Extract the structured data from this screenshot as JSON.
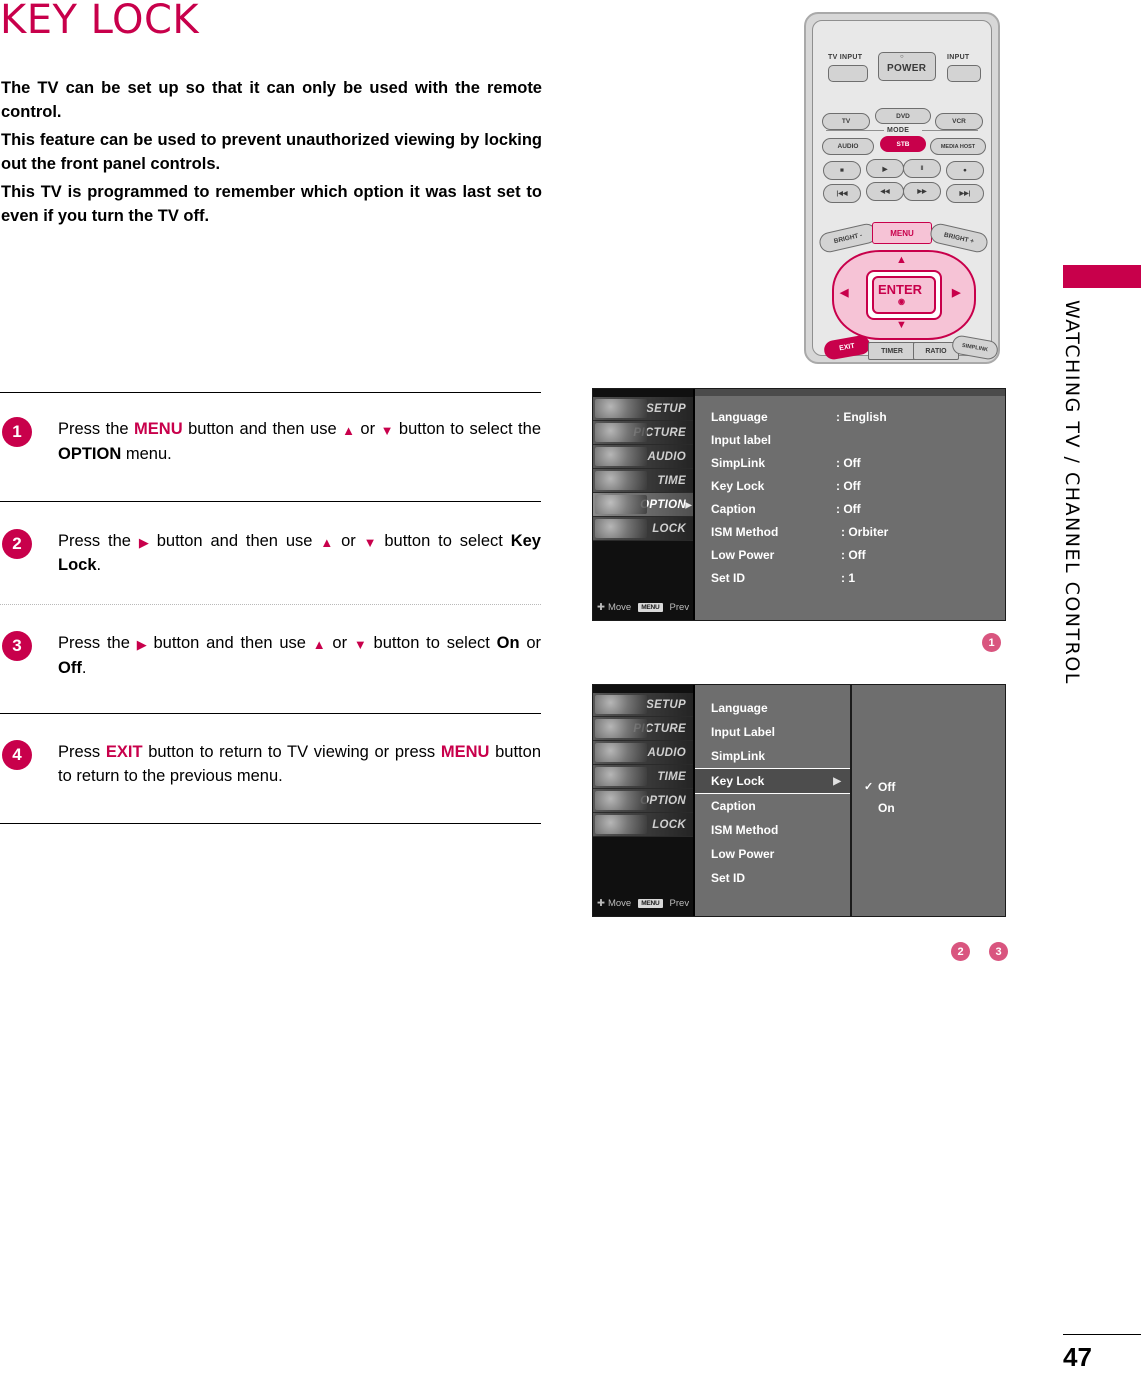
{
  "title": "KEY LOCK",
  "intro": {
    "p1": "The TV can be set up so that it can only be used with the remote control.",
    "p2": "This feature can be used to prevent unauthorized viewing by locking out the front panel controls.",
    "p3": "This TV is programmed to remember which option it was last set to even if you turn the TV off."
  },
  "steps": [
    {
      "num": "1",
      "seg": [
        "Press the ",
        "MENU",
        " button and then use ",
        "▲",
        " or ",
        "▼",
        " button to select the ",
        "OPTION",
        " menu."
      ]
    },
    {
      "num": "2",
      "seg": [
        "Press the ",
        "▶",
        " button and then use ",
        "▲",
        " or ",
        "▼",
        " button to select ",
        "Key Lock",
        "."
      ]
    },
    {
      "num": "3",
      "seg": [
        "Press the ",
        "▶",
        " button and then use ",
        "▲",
        " or ",
        "▼",
        " button to select ",
        "On",
        " or ",
        "Off",
        "."
      ]
    },
    {
      "num": "4",
      "seg": [
        "Press ",
        "EXIT",
        " button to return to TV viewing or press ",
        "MENU",
        " button to return to the previous menu."
      ]
    }
  ],
  "sidebar": {
    "label": "WATCHING TV / CHANNEL CONTROL"
  },
  "footer": {
    "page_number": "47"
  },
  "remote": {
    "tv_input": "TV INPUT",
    "power": "POWER",
    "power_symbol": "○",
    "input": "INPUT",
    "mode": "MODE",
    "tv": "TV",
    "dvd": "DVD",
    "vcr": "VCR",
    "audio": "AUDIO",
    "stb": "STB",
    "media_host": "MEDIA HOST",
    "stop": "■",
    "play": "▶",
    "pause": "‖",
    "record": "●",
    "skip_back": "|◀◀",
    "rewind": "◀◀",
    "forward": "▶▶",
    "skip_fwd": "▶▶|",
    "bright_minus": "BRIGHT -",
    "menu": "MENU",
    "bright_plus": "BRIGHT +",
    "up": "▲",
    "down": "▼",
    "left": "◀",
    "right": "▶",
    "enter": "ENTER",
    "enter_dot": "◉",
    "exit": "EXIT",
    "timer": "TIMER",
    "ratio": "RATIO",
    "simplink": "SIMPLINK"
  },
  "osd1": {
    "badge": "1",
    "side_items": [
      {
        "label": "SETUP",
        "selected": false
      },
      {
        "label": "PICTURE",
        "selected": false
      },
      {
        "label": "AUDIO",
        "selected": false
      },
      {
        "label": "TIME",
        "selected": false
      },
      {
        "label": "OPTION",
        "selected": true
      },
      {
        "label": "LOCK",
        "selected": false
      }
    ],
    "footer_move": "Move",
    "footer_menu_key": "MENU",
    "footer_prev": "Prev",
    "rows": [
      {
        "label": "Language",
        "value": ": English"
      },
      {
        "label": "Input label",
        "value": ""
      },
      {
        "label": "SimpLink",
        "value": ": Off"
      },
      {
        "label": "Key Lock",
        "value": ": Off"
      },
      {
        "label": "Caption",
        "value": ": Off"
      },
      {
        "label": "ISM Method",
        "value": ": Orbiter"
      },
      {
        "label": "Low Power",
        "value": ": Off"
      },
      {
        "label": "Set ID",
        "value": ": 1"
      }
    ]
  },
  "osd2": {
    "badges": [
      "2",
      "3"
    ],
    "side_items": [
      {
        "label": "SETUP",
        "selected": false
      },
      {
        "label": "PICTURE",
        "selected": false
      },
      {
        "label": "AUDIO",
        "selected": false
      },
      {
        "label": "TIME",
        "selected": false
      },
      {
        "label": "OPTION",
        "selected": false
      },
      {
        "label": "LOCK",
        "selected": false
      }
    ],
    "footer_move": "Move",
    "footer_menu_key": "MENU",
    "footer_prev": "Prev",
    "items": [
      {
        "label": "Language",
        "selected": false
      },
      {
        "label": "Input Label",
        "selected": false
      },
      {
        "label": "SimpLink",
        "selected": false
      },
      {
        "label": "Key Lock",
        "selected": true
      },
      {
        "label": "Caption",
        "selected": false
      },
      {
        "label": "ISM Method",
        "selected": false
      },
      {
        "label": "Low Power",
        "selected": false
      },
      {
        "label": "Set ID",
        "selected": false
      }
    ],
    "options": [
      {
        "label": "Off",
        "checked": true
      },
      {
        "label": "On",
        "checked": false
      }
    ],
    "arrow": "▶",
    "check": "✓"
  },
  "colors": {
    "accent": "#c8004b",
    "badge_light": "#d9557f",
    "osd_bg": "#6e6e6e",
    "osd_side_bg": "#101010"
  }
}
